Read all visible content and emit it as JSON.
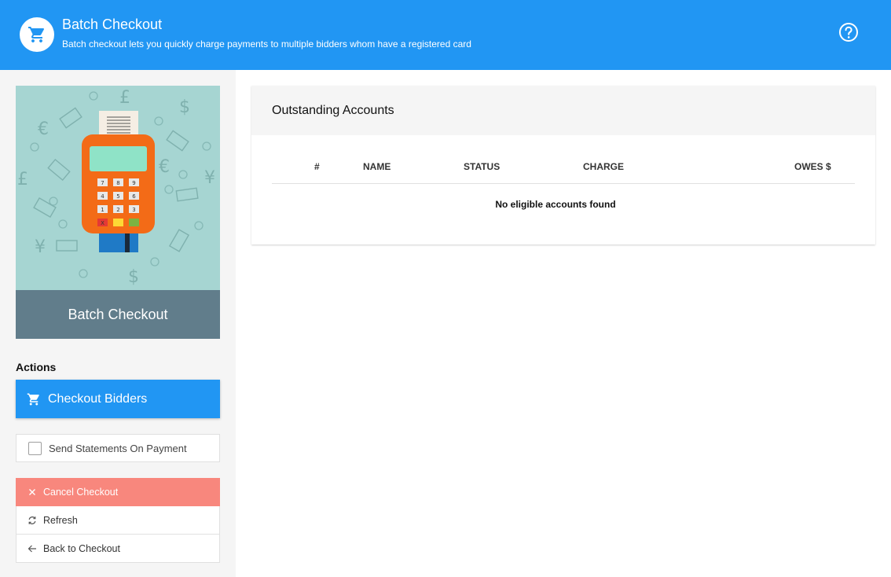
{
  "header": {
    "title": "Batch Checkout",
    "subtitle": "Batch checkout lets you quickly charge payments to multiple bidders whom have a registered card",
    "icon": "cart-icon",
    "help_icon": "help-circle-icon",
    "color": "#2196f3"
  },
  "sidebar": {
    "hero_title": "Batch Checkout",
    "actions_label": "Actions",
    "checkout_button": "Checkout Bidders",
    "send_statements_label": "Send Statements On Payment",
    "send_statements_checked": false,
    "menu": [
      {
        "label": "Cancel Checkout",
        "icon": "close-icon",
        "color": "#f8877d"
      },
      {
        "label": "Refresh",
        "icon": "refresh-icon"
      },
      {
        "label": "Back to Checkout",
        "icon": "arrow-left-icon"
      }
    ]
  },
  "main": {
    "card_title": "Outstanding Accounts",
    "columns": [
      "#",
      "NAME",
      "STATUS",
      "CHARGE",
      "OWES $"
    ],
    "empty_message": "No eligible accounts found"
  }
}
